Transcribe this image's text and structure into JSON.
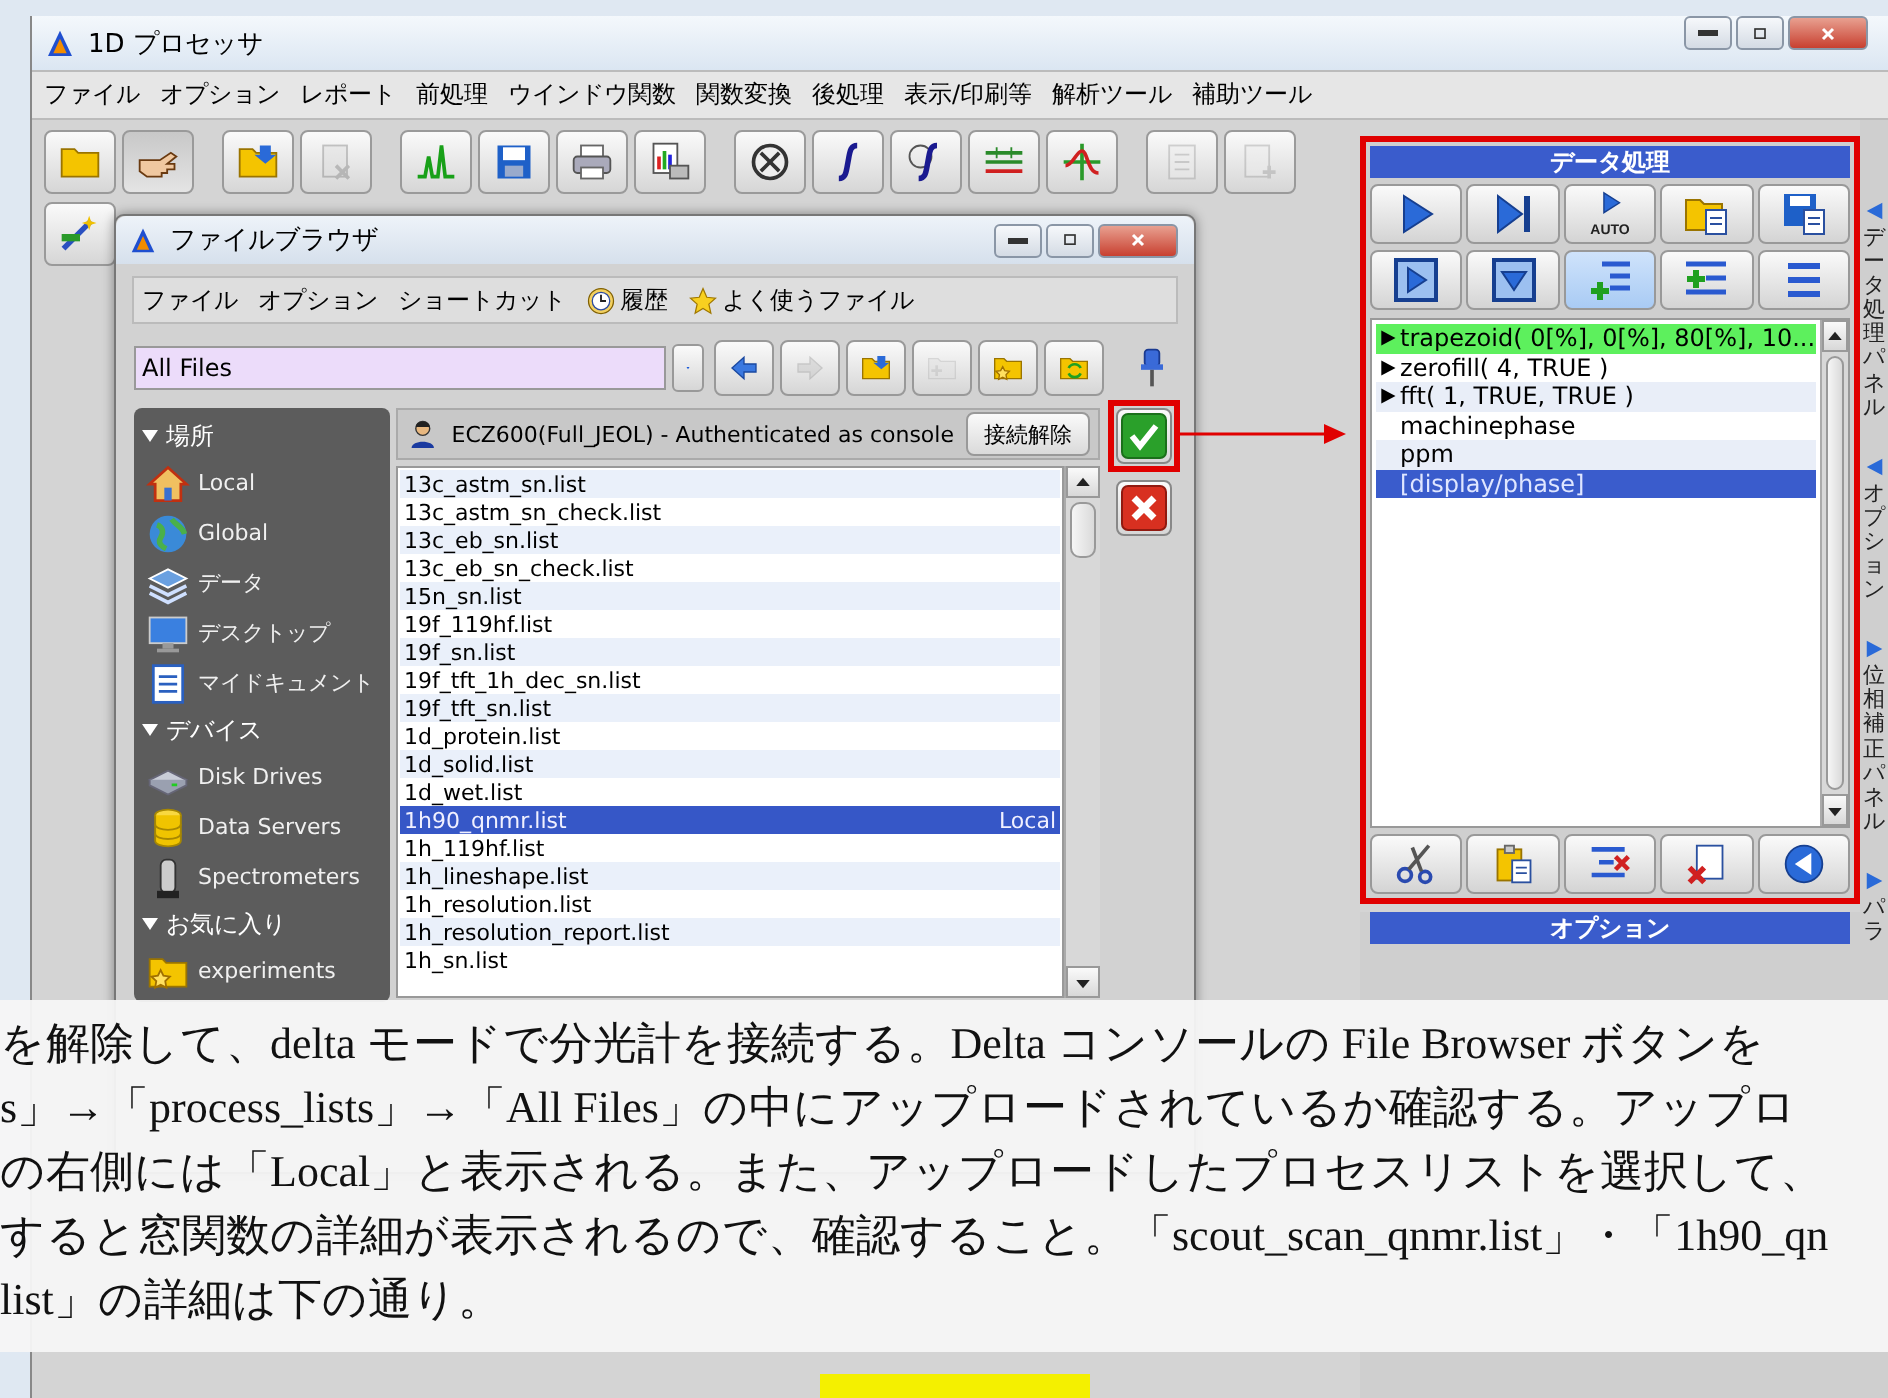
{
  "window": {
    "title": "1D プロセッサ"
  },
  "menu": [
    "ファイル",
    "オプション",
    "レポート",
    "前処理",
    "ウインドウ関数",
    "関数変換",
    "後処理",
    "表示/印刷等",
    "解析ツール",
    "補助ツール"
  ],
  "toolbar": [
    [
      {
        "disabled": false,
        "pressed": false
      },
      {
        "disabled": false,
        "pressed": true
      }
    ],
    [
      {
        "disabled": false,
        "pressed": false
      },
      {
        "disabled": true,
        "pressed": false
      }
    ],
    [
      {
        "disabled": false,
        "pressed": false
      },
      {
        "disabled": false,
        "pressed": false
      },
      {
        "disabled": false,
        "pressed": false
      },
      {
        "disabled": false,
        "pressed": false
      }
    ],
    [
      {
        "disabled": false,
        "pressed": false
      },
      {
        "disabled": false,
        "pressed": false
      },
      {
        "disabled": false,
        "pressed": false
      },
      {
        "disabled": false,
        "pressed": false
      },
      {
        "disabled": false,
        "pressed": false
      }
    ],
    [
      {
        "disabled": true,
        "pressed": false
      },
      {
        "disabled": true,
        "pressed": false
      }
    ]
  ],
  "file_browser": {
    "title": "ファイルブラウザ",
    "menu": [
      {
        "label": "ファイル",
        "kind": "plain"
      },
      {
        "label": "オプション",
        "kind": "plain"
      },
      {
        "label": "ショートカット",
        "kind": "plain"
      },
      {
        "label": "履歴",
        "kind": "history"
      },
      {
        "label": "よく使うファイル",
        "kind": "favorites"
      }
    ],
    "path": {
      "value": "All Files"
    },
    "nav_buttons": [
      {
        "disabled": false
      },
      {
        "disabled": true
      },
      {
        "disabled": false
      },
      {
        "disabled": true
      },
      {
        "disabled": false
      },
      {
        "disabled": false
      }
    ],
    "places": [
      {
        "heading": "場所",
        "expanded": true,
        "items": [
          "Local",
          "Global",
          "データ",
          "デスクトップ",
          "マイドキュメント"
        ]
      },
      {
        "heading": "デバイス",
        "expanded": true,
        "items": [
          "Disk Drives",
          "Data Servers",
          "Spectrometers"
        ]
      },
      {
        "heading": "お気に入り",
        "expanded": true,
        "items": [
          "experiments"
        ]
      }
    ],
    "connection": {
      "label": "ECZ600(Full_JEOL) - Authenticated as console",
      "button": "接続解除"
    },
    "files": [
      {
        "name": "13c_astm_sn.list",
        "selected": false
      },
      {
        "name": "13c_astm_sn_check.list",
        "selected": false
      },
      {
        "name": "13c_eb_sn.list",
        "selected": false
      },
      {
        "name": "13c_eb_sn_check.list",
        "selected": false
      },
      {
        "name": "15n_sn.list",
        "selected": false
      },
      {
        "name": "19f_119hf.list",
        "selected": false
      },
      {
        "name": "19f_sn.list",
        "selected": false
      },
      {
        "name": "19f_tft_1h_dec_sn.list",
        "selected": false
      },
      {
        "name": "19f_tft_sn.list",
        "selected": false
      },
      {
        "name": "1d_protein.list",
        "selected": false
      },
      {
        "name": "1d_solid.list",
        "selected": false
      },
      {
        "name": "1d_wet.list",
        "selected": false
      },
      {
        "name": "1h90_qnmr.list",
        "selected": true,
        "location": "Local"
      },
      {
        "name": "1h_119hf.list",
        "selected": false
      },
      {
        "name": "1h_lineshape.list",
        "selected": false
      },
      {
        "name": "1h_resolution.list",
        "selected": false
      },
      {
        "name": "1h_resolution_report.list",
        "selected": false
      },
      {
        "name": "1h_sn.list",
        "selected": false
      }
    ]
  },
  "data_panel": {
    "title": "データ処理",
    "auto_label": "AUTO",
    "tool_buttons": [
      {
        "selected": false
      },
      {
        "selected": false
      },
      {
        "selected": true
      },
      {
        "selected": false
      },
      {
        "selected": false
      }
    ],
    "steps": [
      {
        "text": "trapezoid( 0[%], 0[%], 80[%], 10...",
        "expandable": true,
        "current": true,
        "selected": false
      },
      {
        "text": "zerofill( 4, TRUE )",
        "expandable": true,
        "current": false,
        "selected": false
      },
      {
        "text": "fft( 1, TRUE, TRUE )",
        "expandable": true,
        "current": false,
        "selected": false
      },
      {
        "text": "machinephase",
        "expandable": false,
        "current": false,
        "selected": false
      },
      {
        "text": "ppm",
        "expandable": false,
        "current": false,
        "selected": false
      },
      {
        "text": "[display/phase]",
        "expandable": false,
        "current": false,
        "selected": true
      }
    ]
  },
  "options_panel": {
    "title": "オプション"
  },
  "side_tabs": [
    {
      "label": "データ処理パネル",
      "expanded": true
    },
    {
      "label": "オプション",
      "expanded": true
    },
    {
      "label": "位相補正パネル",
      "expanded": false
    },
    {
      "label": "パラ",
      "expanded": false
    }
  ],
  "note": {
    "lines": [
      "を解除して、delta モードで分光計を接続する。Delta コンソールの File Browser ボタンを",
      "s」→「process_lists」→「All Files」の中にアップロードされているか確認する。アップロ",
      "の右側には「Local」と表示される。また、アップロードしたプロセスリストを選択して、",
      "すると窓関数の詳細が表示されるので、確認すること。「scout_scan_qnmr.list」・「1h90_qn",
      "list」の詳細は下の通り。"
    ]
  }
}
